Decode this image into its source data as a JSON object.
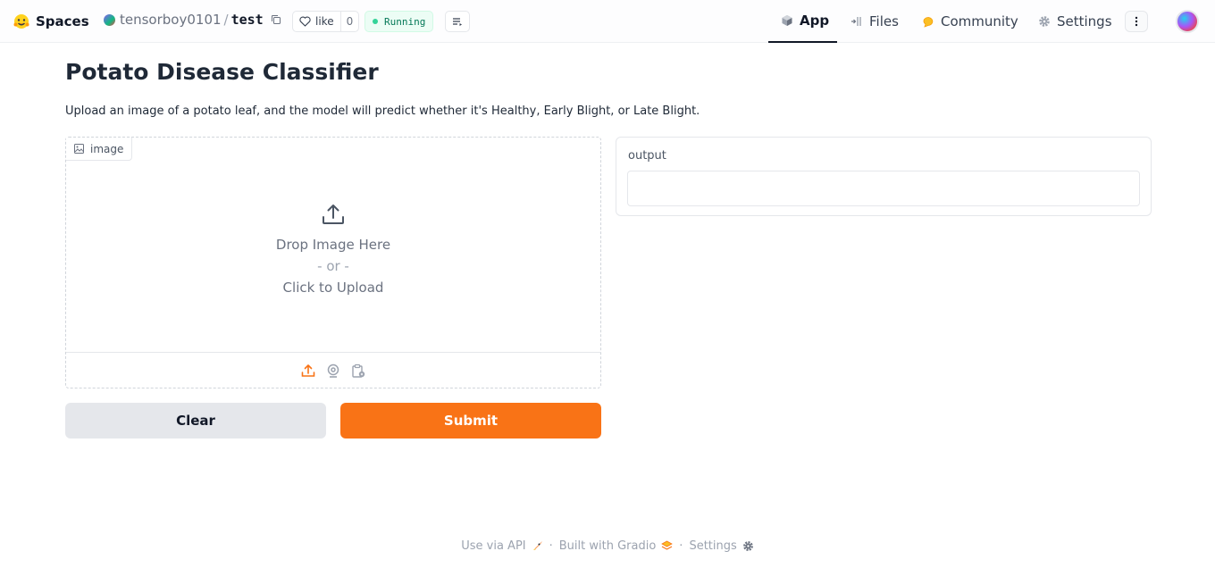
{
  "header": {
    "brand": "Spaces",
    "owner": "tensorboy0101",
    "separator": "/",
    "repo": "test",
    "like_label": "like",
    "like_count": "0",
    "status": "Running",
    "tabs": {
      "app": "App",
      "files": "Files",
      "community": "Community",
      "settings": "Settings"
    }
  },
  "main": {
    "title": "Potato Disease Classifier",
    "description": "Upload an image of a potato leaf, and the model will predict whether it's Healthy, Early Blight, or Late Blight.",
    "image_input": {
      "label": "image",
      "drop_text": "Drop Image Here",
      "or_text": "- or -",
      "click_text": "Click to Upload"
    },
    "clear_label": "Clear",
    "submit_label": "Submit",
    "output": {
      "label": "output",
      "value": ""
    }
  },
  "footer": {
    "api": "Use via API",
    "built": "Built with Gradio",
    "settings": "Settings",
    "dot": "·"
  },
  "colors": {
    "accent": "#f97316",
    "running": "#34d399"
  }
}
